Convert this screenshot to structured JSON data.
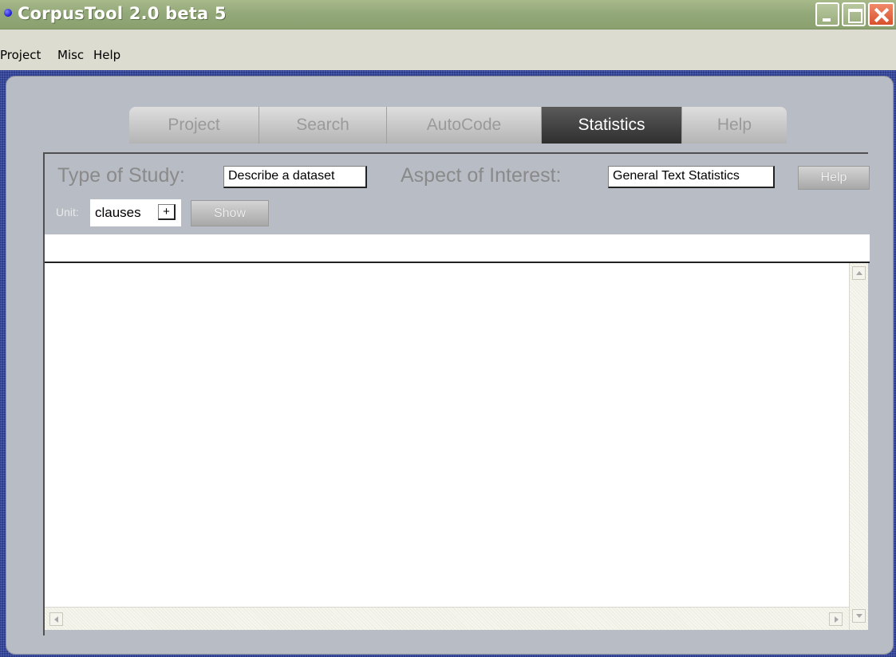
{
  "window": {
    "title": "CorpusTool 2.0 beta 5"
  },
  "menubar": {
    "items": [
      "Project",
      "Misc",
      "Help"
    ]
  },
  "tabs": [
    {
      "label": "Project",
      "active": false
    },
    {
      "label": "Search",
      "active": false
    },
    {
      "label": "AutoCode",
      "active": false
    },
    {
      "label": "Statistics",
      "active": true
    },
    {
      "label": "Help",
      "active": false
    }
  ],
  "statistics": {
    "type_of_study_label": "Type of Study:",
    "type_of_study_value": "Describe a dataset",
    "aspect_label": "Aspect of Interest:",
    "aspect_value": "General Text Statistics",
    "help_button": "Help",
    "unit_label": "Unit:",
    "unit_value": "clauses",
    "unit_add": "+",
    "show_button": "Show"
  },
  "colors": {
    "titlebar": "#94a97a",
    "frame": "#22337a",
    "panel": "#b8bcc4",
    "active_tab": "#3a3a3a"
  }
}
